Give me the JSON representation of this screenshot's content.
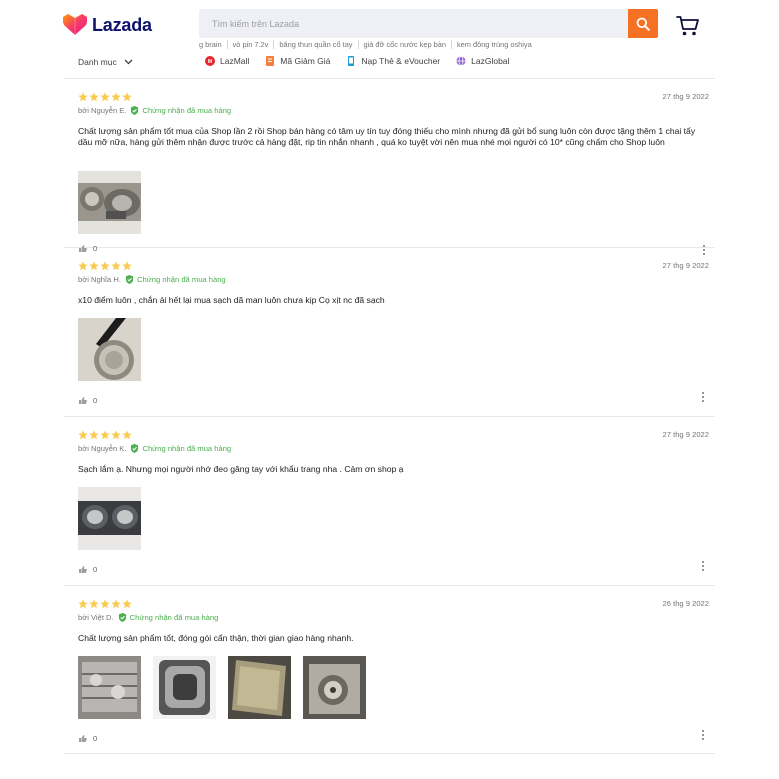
{
  "header": {
    "logo_text": "Lazada",
    "search_placeholder": "Tìm kiếm trên Lazada",
    "suggestions": [
      "g brain",
      "vỏ pin 7.2v",
      "băng thun quần cổ tay",
      "giá đỡ cốc nước kẹp bàn",
      "kem đông trùng oshiya"
    ],
    "category_label": "Danh mục",
    "quick_links": [
      "LazMall",
      "Mã Giảm Giá",
      "Nạp Thẻ & eVoucher",
      "LazGlobal"
    ],
    "colors": {
      "brand": "#f57224",
      "logo_text": "#0f136d",
      "star": "#faca51",
      "verified": "#4caf50"
    }
  },
  "reviews": [
    {
      "rating": 5,
      "date": "27 thg 9 2022",
      "author": "bởi Nguyễn E.",
      "verified_label": "Chứng nhận đã mua hàng",
      "content": "Chất lượng sản phẩm tốt mua của Shop lần 2 rồi Shop bán hàng có tâm uy tín tuy đóng thiếu cho mình nhưng đã gửi bổ sung luôn còn được tặng thêm 1 chai tẩy dầu mỡ nữa, hàng gửi thêm nhận được trước cả hàng đặt, rip tin nhắn nhanh , quá ko tuyệt vời nên mua nhé mọi người có 10* cũng chấm cho Shop luôn",
      "image_count": 1,
      "likes": "0"
    },
    {
      "rating": 5,
      "date": "27 thg 9 2022",
      "author": "bởi Nghĩa H.",
      "verified_label": "Chứng nhận đã mua hàng",
      "content": "x10 điểm luôn , chắn ải hết lại mua sạch dã man luôn chưa kịp Cọ xịt nc đã sạch",
      "image_count": 1,
      "likes": "0"
    },
    {
      "rating": 5,
      "date": "27 thg 9 2022",
      "author": "bởi Nguyễn K.",
      "verified_label": "Chứng nhận đã mua hàng",
      "content": "Sạch lắm ạ. Nhưng mọi người nhớ đeo găng tay với khẩu trang nha . Cảm ơn shop ạ",
      "image_count": 1,
      "likes": "0"
    },
    {
      "rating": 5,
      "date": "26 thg 9 2022",
      "author": "bởi Việt D.",
      "verified_label": "Chứng nhận đã mua hàng",
      "content": "Chất lượng sản phẩm tốt, đóng gói cẩn thận, thời gian giao hàng nhanh.",
      "image_count": 4,
      "likes": "0"
    }
  ]
}
